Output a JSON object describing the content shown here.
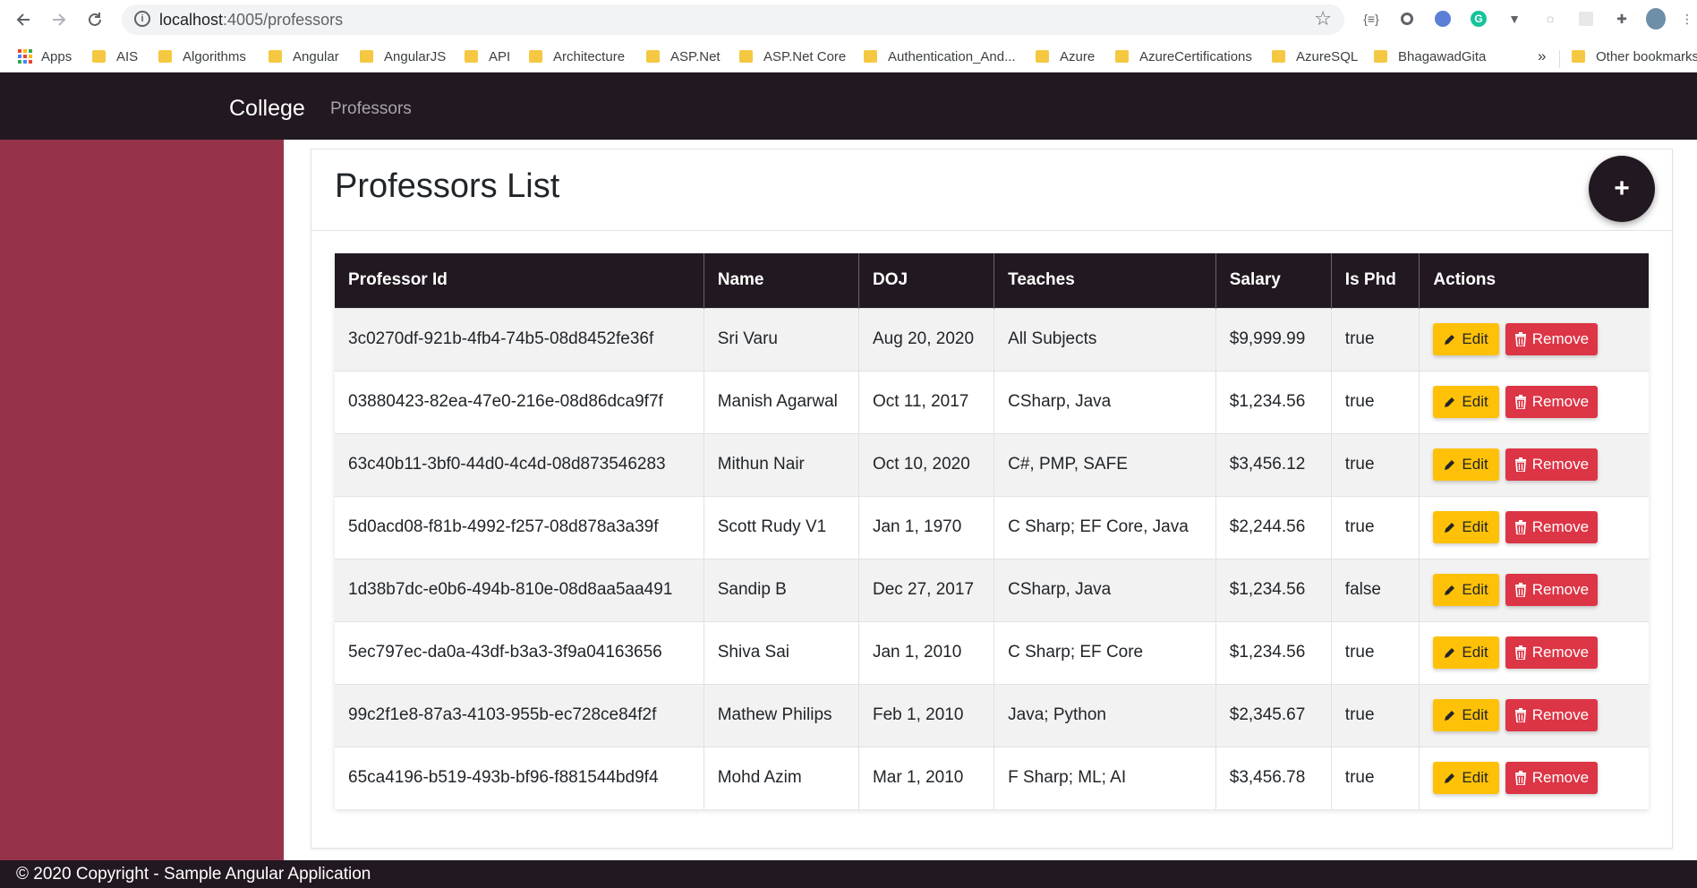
{
  "browser": {
    "url_host": "localhost",
    "url_path": ":4005/professors",
    "bookmarks": [
      {
        "label": "Apps",
        "icon": "apps-grid-icon"
      },
      {
        "label": "AIS",
        "icon": "folder-icon"
      },
      {
        "label": "Algorithms",
        "icon": "folder-icon"
      },
      {
        "label": "Angular",
        "icon": "folder-icon"
      },
      {
        "label": "AngularJS",
        "icon": "folder-icon"
      },
      {
        "label": "API",
        "icon": "folder-icon"
      },
      {
        "label": "Architecture",
        "icon": "folder-icon"
      },
      {
        "label": "ASP.Net",
        "icon": "folder-icon"
      },
      {
        "label": "ASP.Net Core",
        "icon": "folder-icon"
      },
      {
        "label": "Authentication_And...",
        "icon": "folder-icon"
      },
      {
        "label": "Azure",
        "icon": "folder-icon"
      },
      {
        "label": "AzureCertifications",
        "icon": "folder-icon"
      },
      {
        "label": "AzureSQL",
        "icon": "folder-icon"
      },
      {
        "label": "BhagawadGita",
        "icon": "folder-icon"
      }
    ],
    "overflow_label": "»",
    "other_bookmarks": "Other bookmarks"
  },
  "header": {
    "brand": "College",
    "nav_link": "Professors"
  },
  "card": {
    "title": "Professors List",
    "add_label": "+"
  },
  "table": {
    "columns": [
      "Professor Id",
      "Name",
      "DOJ",
      "Teaches",
      "Salary",
      "Is Phd",
      "Actions"
    ],
    "edit_label": "Edit",
    "remove_label": "Remove",
    "rows": [
      {
        "id": "3c0270df-921b-4fb4-74b5-08d8452fe36f",
        "name": "Sri Varu",
        "doj": "Aug 20, 2020",
        "teaches": "All Subjects",
        "salary": "$9,999.99",
        "phd": "true"
      },
      {
        "id": "03880423-82ea-47e0-216e-08d86dca9f7f",
        "name": "Manish Agarwal",
        "doj": "Oct 11, 2017",
        "teaches": "CSharp, Java",
        "salary": "$1,234.56",
        "phd": "true"
      },
      {
        "id": "63c40b11-3bf0-44d0-4c4d-08d873546283",
        "name": "Mithun Nair",
        "doj": "Oct 10, 2020",
        "teaches": "C#, PMP, SAFE",
        "salary": "$3,456.12",
        "phd": "true"
      },
      {
        "id": "5d0acd08-f81b-4992-f257-08d878a3a39f",
        "name": "Scott Rudy V1",
        "doj": "Jan 1, 1970",
        "teaches": "C Sharp; EF Core, Java",
        "salary": "$2,244.56",
        "phd": "true"
      },
      {
        "id": "1d38b7dc-e0b6-494b-810e-08d8aa5aa491",
        "name": "Sandip B",
        "doj": "Dec 27, 2017",
        "teaches": "CSharp, Java",
        "salary": "$1,234.56",
        "phd": "false"
      },
      {
        "id": "5ec797ec-da0a-43df-b3a3-3f9a04163656",
        "name": "Shiva Sai",
        "doj": "Jan 1, 2010",
        "teaches": "C Sharp; EF Core",
        "salary": "$1,234.56",
        "phd": "true"
      },
      {
        "id": "99c2f1e8-87a3-4103-955b-ec728ce84f2f",
        "name": "Mathew Philips",
        "doj": "Feb 1, 2010",
        "teaches": "Java; Python",
        "salary": "$2,345.67",
        "phd": "true"
      },
      {
        "id": "65ca4196-b519-493b-bf96-f881544bd9f4",
        "name": "Mohd Azim",
        "doj": "Mar 1, 2010",
        "teaches": "F Sharp; ML; AI",
        "salary": "$3,456.78",
        "phd": "true"
      }
    ]
  },
  "footer": {
    "text": "© 2020 Copyright - Sample Angular Application"
  },
  "colors": {
    "header_bg": "#221821",
    "sidebar_bg": "#96334a",
    "edit_btn": "#ffc107",
    "remove_btn": "#dc3545"
  }
}
